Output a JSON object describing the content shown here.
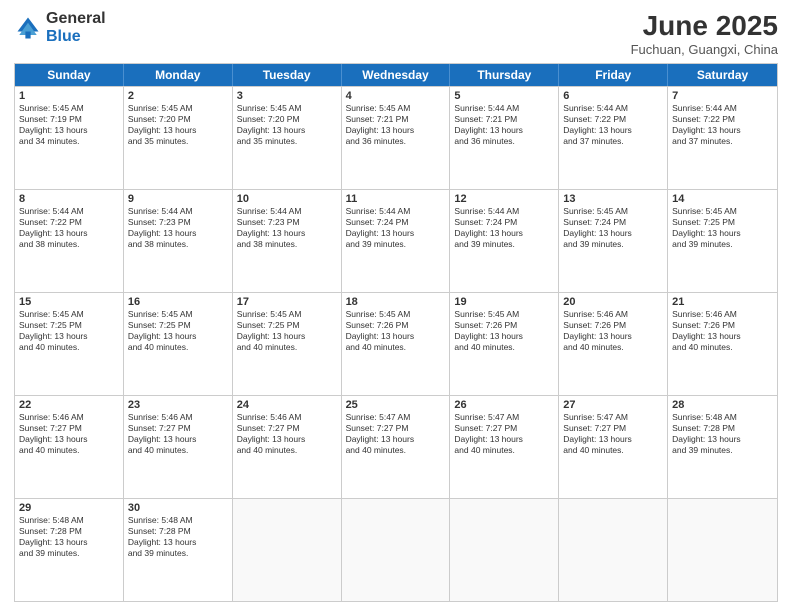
{
  "logo": {
    "general": "General",
    "blue": "Blue"
  },
  "title": "June 2025",
  "subtitle": "Fuchuan, Guangxi, China",
  "header_days": [
    "Sunday",
    "Monday",
    "Tuesday",
    "Wednesday",
    "Thursday",
    "Friday",
    "Saturday"
  ],
  "weeks": [
    [
      {
        "day": "1",
        "text": "Sunrise: 5:45 AM\nSunset: 7:19 PM\nDaylight: 13 hours\nand 34 minutes."
      },
      {
        "day": "2",
        "text": "Sunrise: 5:45 AM\nSunset: 7:20 PM\nDaylight: 13 hours\nand 35 minutes."
      },
      {
        "day": "3",
        "text": "Sunrise: 5:45 AM\nSunset: 7:20 PM\nDaylight: 13 hours\nand 35 minutes."
      },
      {
        "day": "4",
        "text": "Sunrise: 5:45 AM\nSunset: 7:21 PM\nDaylight: 13 hours\nand 36 minutes."
      },
      {
        "day": "5",
        "text": "Sunrise: 5:44 AM\nSunset: 7:21 PM\nDaylight: 13 hours\nand 36 minutes."
      },
      {
        "day": "6",
        "text": "Sunrise: 5:44 AM\nSunset: 7:22 PM\nDaylight: 13 hours\nand 37 minutes."
      },
      {
        "day": "7",
        "text": "Sunrise: 5:44 AM\nSunset: 7:22 PM\nDaylight: 13 hours\nand 37 minutes."
      }
    ],
    [
      {
        "day": "8",
        "text": "Sunrise: 5:44 AM\nSunset: 7:22 PM\nDaylight: 13 hours\nand 38 minutes."
      },
      {
        "day": "9",
        "text": "Sunrise: 5:44 AM\nSunset: 7:23 PM\nDaylight: 13 hours\nand 38 minutes."
      },
      {
        "day": "10",
        "text": "Sunrise: 5:44 AM\nSunset: 7:23 PM\nDaylight: 13 hours\nand 38 minutes."
      },
      {
        "day": "11",
        "text": "Sunrise: 5:44 AM\nSunset: 7:24 PM\nDaylight: 13 hours\nand 39 minutes."
      },
      {
        "day": "12",
        "text": "Sunrise: 5:44 AM\nSunset: 7:24 PM\nDaylight: 13 hours\nand 39 minutes."
      },
      {
        "day": "13",
        "text": "Sunrise: 5:45 AM\nSunset: 7:24 PM\nDaylight: 13 hours\nand 39 minutes."
      },
      {
        "day": "14",
        "text": "Sunrise: 5:45 AM\nSunset: 7:25 PM\nDaylight: 13 hours\nand 39 minutes."
      }
    ],
    [
      {
        "day": "15",
        "text": "Sunrise: 5:45 AM\nSunset: 7:25 PM\nDaylight: 13 hours\nand 40 minutes."
      },
      {
        "day": "16",
        "text": "Sunrise: 5:45 AM\nSunset: 7:25 PM\nDaylight: 13 hours\nand 40 minutes."
      },
      {
        "day": "17",
        "text": "Sunrise: 5:45 AM\nSunset: 7:25 PM\nDaylight: 13 hours\nand 40 minutes."
      },
      {
        "day": "18",
        "text": "Sunrise: 5:45 AM\nSunset: 7:26 PM\nDaylight: 13 hours\nand 40 minutes."
      },
      {
        "day": "19",
        "text": "Sunrise: 5:45 AM\nSunset: 7:26 PM\nDaylight: 13 hours\nand 40 minutes."
      },
      {
        "day": "20",
        "text": "Sunrise: 5:46 AM\nSunset: 7:26 PM\nDaylight: 13 hours\nand 40 minutes."
      },
      {
        "day": "21",
        "text": "Sunrise: 5:46 AM\nSunset: 7:26 PM\nDaylight: 13 hours\nand 40 minutes."
      }
    ],
    [
      {
        "day": "22",
        "text": "Sunrise: 5:46 AM\nSunset: 7:27 PM\nDaylight: 13 hours\nand 40 minutes."
      },
      {
        "day": "23",
        "text": "Sunrise: 5:46 AM\nSunset: 7:27 PM\nDaylight: 13 hours\nand 40 minutes."
      },
      {
        "day": "24",
        "text": "Sunrise: 5:46 AM\nSunset: 7:27 PM\nDaylight: 13 hours\nand 40 minutes."
      },
      {
        "day": "25",
        "text": "Sunrise: 5:47 AM\nSunset: 7:27 PM\nDaylight: 13 hours\nand 40 minutes."
      },
      {
        "day": "26",
        "text": "Sunrise: 5:47 AM\nSunset: 7:27 PM\nDaylight: 13 hours\nand 40 minutes."
      },
      {
        "day": "27",
        "text": "Sunrise: 5:47 AM\nSunset: 7:27 PM\nDaylight: 13 hours\nand 40 minutes."
      },
      {
        "day": "28",
        "text": "Sunrise: 5:48 AM\nSunset: 7:28 PM\nDaylight: 13 hours\nand 39 minutes."
      }
    ],
    [
      {
        "day": "29",
        "text": "Sunrise: 5:48 AM\nSunset: 7:28 PM\nDaylight: 13 hours\nand 39 minutes."
      },
      {
        "day": "30",
        "text": "Sunrise: 5:48 AM\nSunset: 7:28 PM\nDaylight: 13 hours\nand 39 minutes."
      },
      {
        "day": "",
        "text": ""
      },
      {
        "day": "",
        "text": ""
      },
      {
        "day": "",
        "text": ""
      },
      {
        "day": "",
        "text": ""
      },
      {
        "day": "",
        "text": ""
      }
    ]
  ]
}
